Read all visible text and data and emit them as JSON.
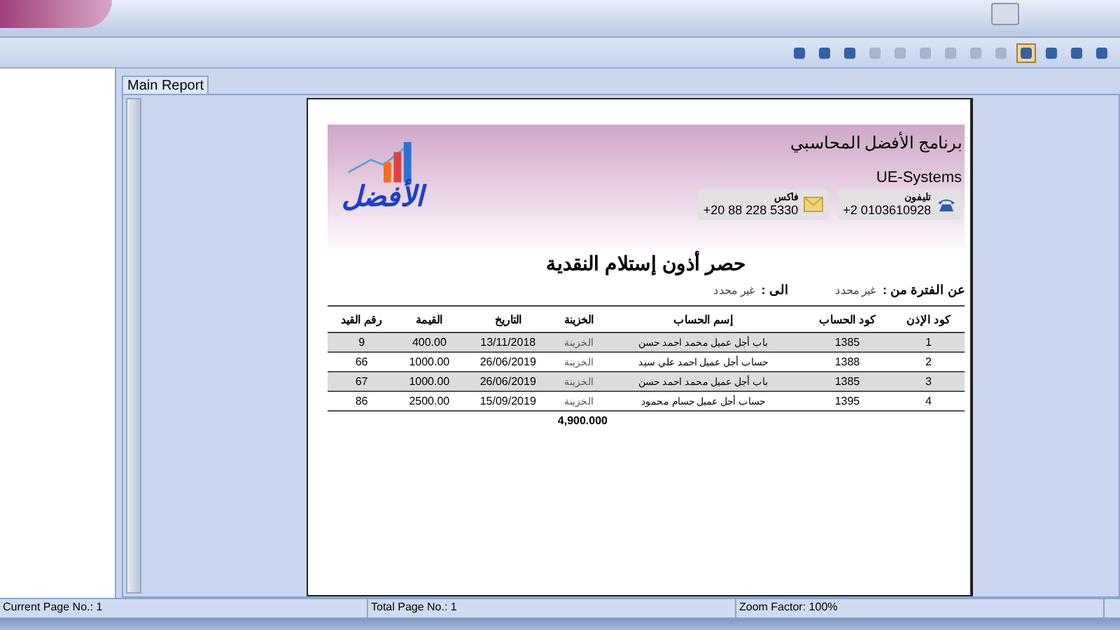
{
  "tab": {
    "label": "Main Report"
  },
  "report": {
    "company": "برنامج الأفضل المحاسبي",
    "subtitle": "UE-Systems",
    "logo_text": "الأفضل",
    "phone": {
      "label": "تليفون",
      "value": "+2 0103610928"
    },
    "fax": {
      "label": "فاكس",
      "value": "+20 88 228 5330"
    },
    "title": "حصر أذون إستلام النقدية",
    "period_from": {
      "label": "عن الفترة من :",
      "value": "غير محدد"
    },
    "period_to": {
      "label": "الى :",
      "value": "غير محدد"
    },
    "columns": [
      "كود الإذن",
      "كود الحساب",
      "إسم الحساب",
      "الخزينة",
      "التاريخ",
      "القيمة",
      "رقم القيد"
    ],
    "rows": [
      [
        "1",
        "1385",
        "باب أجل عميل محمد احمد حسن",
        "الخزينة",
        "13/11/2018",
        "400.00",
        "9"
      ],
      [
        "2",
        "1388",
        "حساب أجل عميل احمد علي سيد",
        "الخزينة",
        "26/06/2019",
        "1000.00",
        "66"
      ],
      [
        "3",
        "1385",
        "باب أجل عميل محمد احمد حسن",
        "الخزينة",
        "26/06/2019",
        "1000.00",
        "67"
      ],
      [
        "4",
        "1395",
        "حساب أجل عميل حسام محمود",
        "الخزينة",
        "15/09/2019",
        "2500.00",
        "86"
      ]
    ],
    "total": "4,900.000"
  },
  "status_bar": {
    "current_page": "Current Page No.: 1",
    "total_pages": "Total Page No.: 1",
    "zoom_factor": "Zoom Factor: 100%"
  }
}
